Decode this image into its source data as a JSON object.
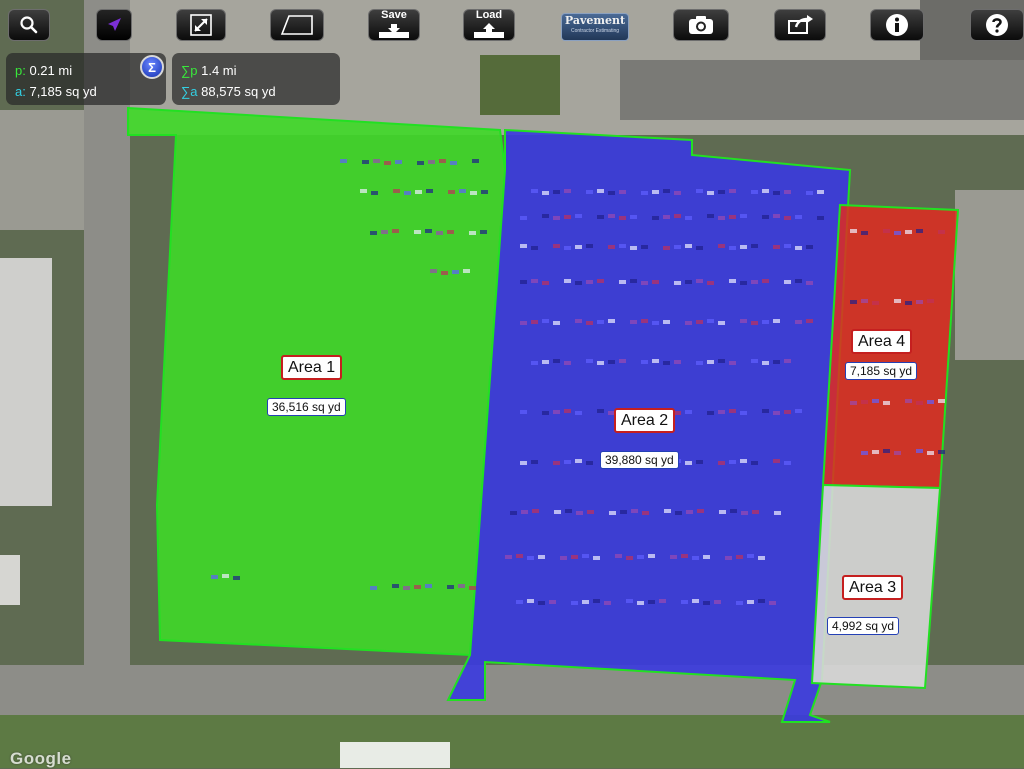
{
  "toolbar": {
    "save_label": "Save",
    "load_label": "Load",
    "logo_text": "Pavement",
    "logo_subtext": "Contractor Estimating"
  },
  "stats": {
    "perimeter_label": "p:",
    "perimeter_value": "0.21 mi",
    "area_label": "a:",
    "area_value": "7,185 sq yd",
    "sigma_symbol": "Σ",
    "total_perimeter_label": "∑p",
    "total_perimeter_value": "1.4 mi",
    "total_area_label": "∑a",
    "total_area_value": "88,575 sq yd"
  },
  "areas": [
    {
      "name": "Area 1",
      "value": "36,516 sq yd",
      "fill": "#3fd928",
      "stroke": "#22e022"
    },
    {
      "name": "Area 2",
      "value": "39,880 sq yd",
      "fill": "#3a3ae0",
      "stroke": "#22e022"
    },
    {
      "name": "Area 3",
      "value": "4,992 sq yd",
      "fill": "#d8d8d8",
      "stroke": "#22e022"
    },
    {
      "name": "Area 4",
      "value": "7,185 sq yd",
      "fill": "#e02a20",
      "stroke": "#22e022"
    }
  ],
  "attribution": "Google",
  "colors": {
    "grass": "#5f6b52",
    "pavement": "#9c9c94",
    "road": "#8d8d88",
    "active_tool": "#7b2fd6"
  }
}
